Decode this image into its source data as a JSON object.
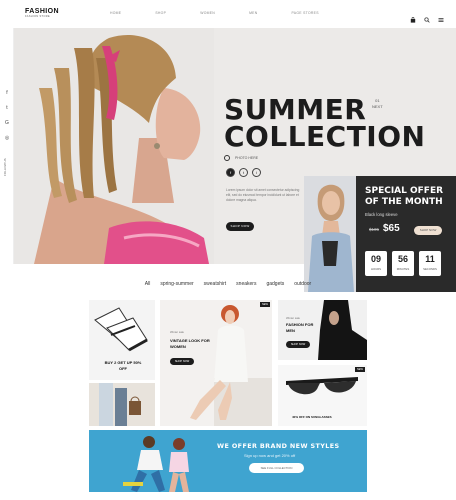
{
  "header": {
    "logo_title": "FASHION",
    "logo_sub": "FASHION STORE",
    "nav": [
      "HOME",
      "SHOP",
      "WOMEN",
      "MEN",
      "PAGE STORES"
    ],
    "icons": [
      "bag-icon",
      "search-icon",
      "menu-icon"
    ]
  },
  "hero": {
    "title_line1": "SUMMER",
    "title_line2": "COLLECTION",
    "play_label": "PHOTO HERE",
    "description": "Lorem ipsum dolor sit amet consectetur adipiscing elit, sed do eiusmod tempor incididunt ut labore et dolore magna aliqua.",
    "shop_now": "SHOP NOW",
    "tag_num": "01",
    "tag_next": "NEXT",
    "social_vertical": "FOLLOW US"
  },
  "offer": {
    "title_line1": "SPECIAL OFFER",
    "title_line2": "OF THE MONTH",
    "subtitle": "Black long sleeve",
    "old_price": "$105",
    "new_price": "$65",
    "button": "SHOP NOW",
    "timer": [
      {
        "value": "09",
        "unit": "HOURS"
      },
      {
        "value": "56",
        "unit": "MINUTES"
      },
      {
        "value": "11",
        "unit": "SECONDS"
      }
    ]
  },
  "filters": [
    "All",
    "spring-summer",
    "sweatshirt",
    "sneakers",
    "gadgets",
    "outdoor"
  ],
  "cards": {
    "sneakers_caption": "BUY 2 GET UP 50% OFF",
    "vintage_small": "Winter sale",
    "vintage_caption": "VINTAGE LOOK FOR WOMEN",
    "vintage_btn": "SHOP NOW",
    "men_small": "Winter sale",
    "men_caption": "FASHION FOR MEN",
    "men_btn": "SHOP NOW",
    "sunglasses_caption": "40% OFF ON SUNGLASSES",
    "badge": "NEW"
  },
  "banner": {
    "heading": "WE OFFER BRAND NEW STYLES",
    "sub": "Sign up now and get 20% off",
    "button": "SEE FULL COLLECTION"
  },
  "colors": {
    "dark": "#1c1c1c",
    "banner": "#3fa4d0",
    "offer_bg": "#2a2a2a",
    "accent_pink": "#d63f7a"
  }
}
